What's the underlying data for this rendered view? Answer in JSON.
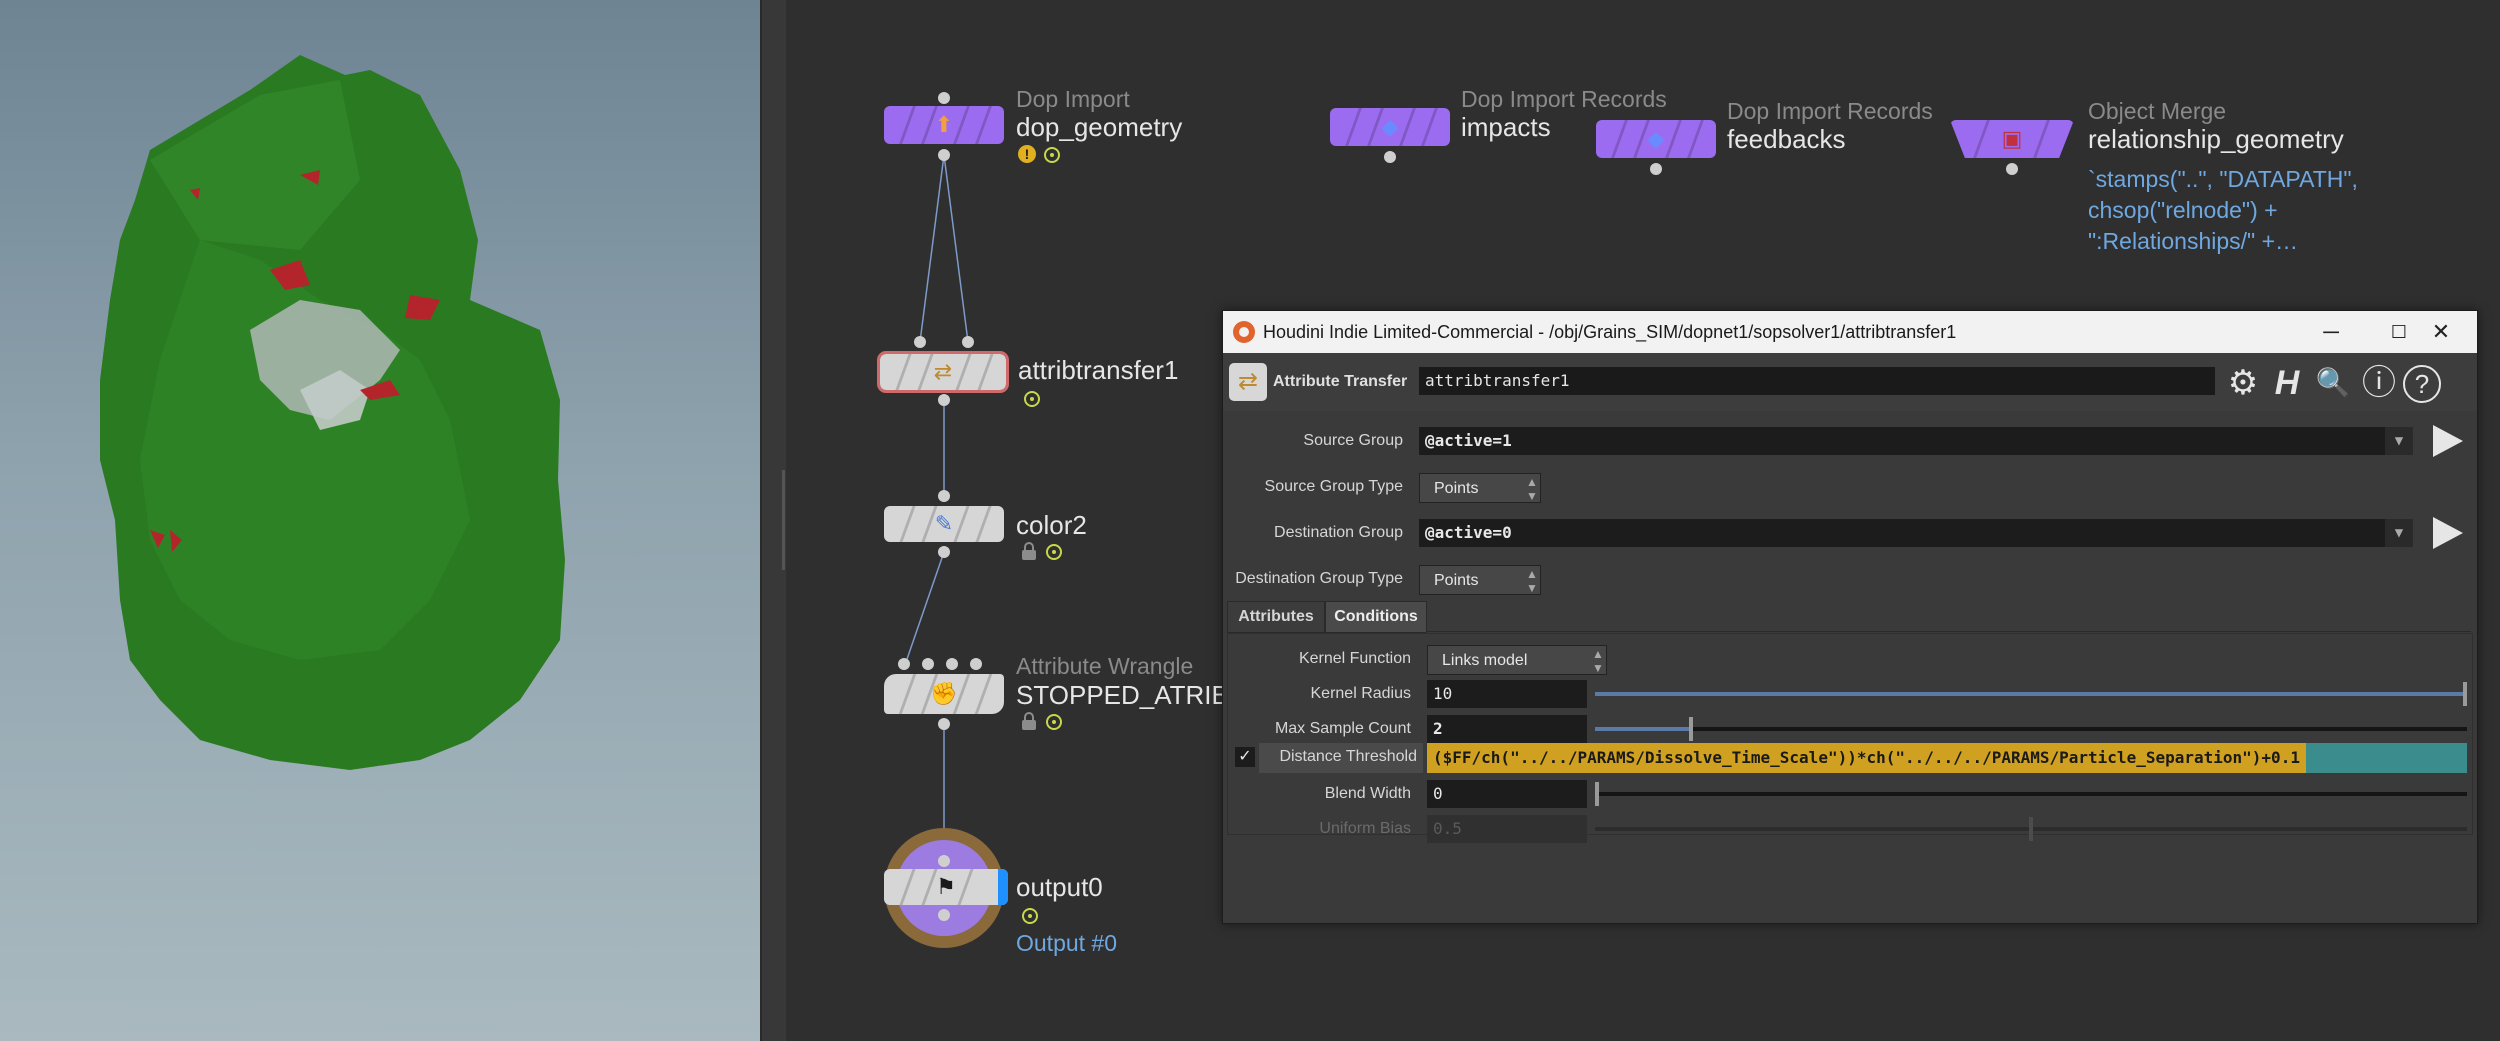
{
  "network": {
    "nodes": [
      {
        "key": "dop_geometry",
        "type": "Dop Import",
        "name": "dop_geometry"
      },
      {
        "key": "impacts",
        "type": "Dop Import Records",
        "name": "impacts"
      },
      {
        "key": "feedbacks",
        "type": "Dop Import Records",
        "name": "feedbacks"
      },
      {
        "key": "relationship_geometry",
        "type": "Object Merge",
        "name": "relationship_geometry",
        "expression_lines": [
          "`stamps(\"..\", \"DATAPATH\",",
          "chsop(\"relnode\") +",
          "\":Relationships/\" +…"
        ]
      },
      {
        "key": "attribtransfer1",
        "type": "",
        "name": "attribtransfer1"
      },
      {
        "key": "color2",
        "type": "",
        "name": "color2"
      },
      {
        "key": "stopped",
        "type": "Attribute Wrangle",
        "name": "STOPPED_ATRIB"
      },
      {
        "key": "output0",
        "type": "",
        "name": "output0",
        "extra": "Output #0"
      }
    ],
    "icons": {
      "dop_import": "dop-import-icon",
      "records": "dop-import-records-icon",
      "merge": "object-merge-icon",
      "transfer": "attribute-transfer-icon",
      "color": "color-icon",
      "wrangle": "attribute-wrangle-icon",
      "output": "output-flag-icon"
    },
    "colors": {
      "dop": "#9c6cf0",
      "sop": "#d6d6d6",
      "selected": "#d06a6a",
      "expression": "#6fa8e0",
      "warning": "#e0b020",
      "ok": "#c8d84a"
    }
  },
  "param_window": {
    "title": "Houdini Indie Limited-Commercial - /obj/Grains_SIM/dopnet1/sopsolver1/attribtransfer1",
    "window_buttons": {
      "minimize": "─",
      "maximize": "☐",
      "close": "✕"
    },
    "header": {
      "node_type": "Attribute Transfer",
      "node_name": "attribtransfer1",
      "buttons": {
        "gear": "⚙",
        "houdini": "H",
        "search": "🔍",
        "info": "ⓘ",
        "help": "?"
      }
    },
    "params": {
      "source_group": {
        "label": "Source Group",
        "value": "@active=1"
      },
      "source_group_type": {
        "label": "Source Group Type",
        "value": "Points"
      },
      "destination_group": {
        "label": "Destination Group",
        "value": "@active=0"
      },
      "destination_group_type": {
        "label": "Destination Group Type",
        "value": "Points"
      }
    },
    "tabs": [
      {
        "label": "Attributes",
        "active": false
      },
      {
        "label": "Conditions",
        "active": true
      }
    ],
    "conditions": {
      "kernel_function": {
        "label": "Kernel Function",
        "value": "Links model"
      },
      "kernel_radius": {
        "label": "Kernel Radius",
        "value": "10",
        "slider_fraction": 1.0
      },
      "max_sample_count": {
        "label": "Max Sample Count",
        "value": "2",
        "slider_fraction": 0.11
      },
      "distance_threshold": {
        "label": "Distance Threshold",
        "enabled": true,
        "check": "✓",
        "expression": "($FF/ch(\"../../PARAMS/Dissolve_Time_Scale\"))*ch(\"../../../PARAMS/Particle_Separation\")+0.1"
      },
      "blend_width": {
        "label": "Blend Width",
        "value": "0",
        "slider_fraction": 0.0
      },
      "uniform_bias": {
        "label": "Uniform Bias",
        "value": "0.5",
        "slider_fraction": 0.5,
        "disabled": true
      }
    }
  }
}
